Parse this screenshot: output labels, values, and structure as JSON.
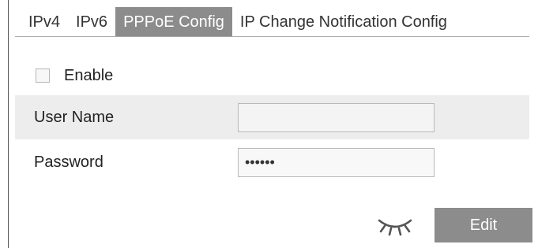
{
  "tabs": [
    {
      "label": "IPv4"
    },
    {
      "label": "IPv6"
    },
    {
      "label": "PPPoE Config"
    },
    {
      "label": "IP Change Notification Config"
    }
  ],
  "form": {
    "enable_label": "Enable",
    "enable_checked": false,
    "username_label": "User Name",
    "username_value": "",
    "password_label": "Password",
    "password_value": "••••••"
  },
  "actions": {
    "reveal_icon": "eye-closed-icon",
    "edit_label": "Edit"
  },
  "colors": {
    "active_tab": "#8c8c8c",
    "button": "#8c8c8c",
    "row_shade": "#ededed"
  }
}
